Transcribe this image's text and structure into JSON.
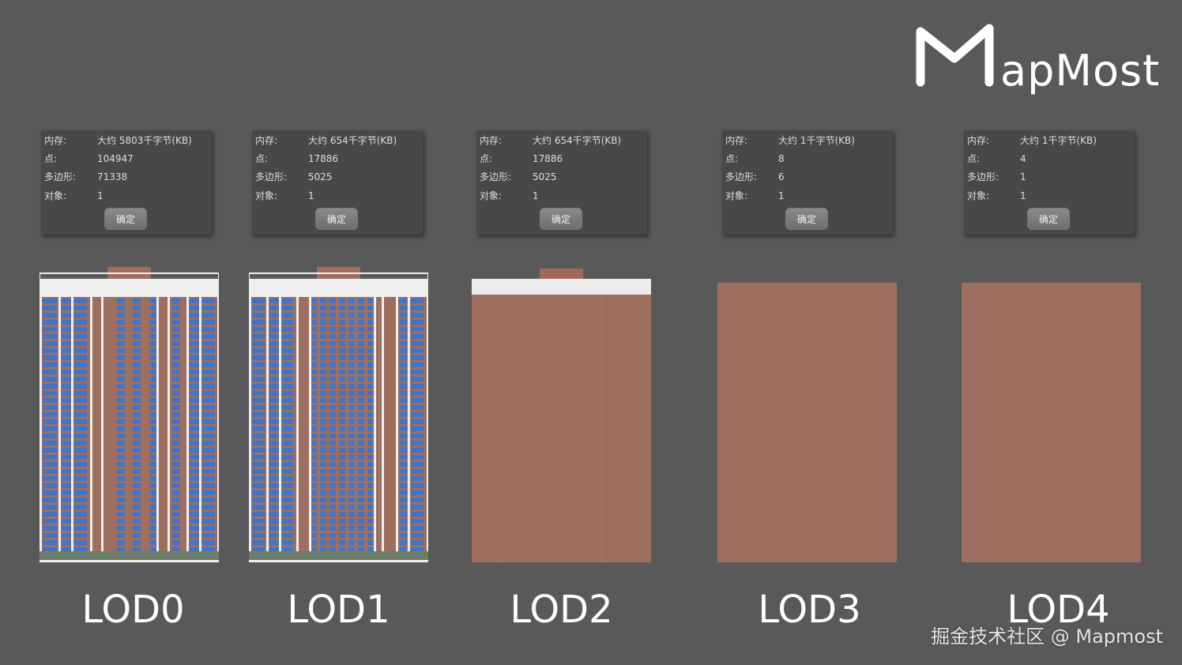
{
  "brand": {
    "name": "apMost",
    "color": "#ffffff"
  },
  "colors": {
    "background": "#595959",
    "brick": "#9e6e5e",
    "window_blue": "#3f74c8",
    "frame": "#efefef"
  },
  "lods": [
    {
      "label": "LOD0",
      "memory_label": "内存:",
      "memory": "大约 5803千字节(KB)",
      "points_label": "点:",
      "points": "104947",
      "polygons_label": "多边形:",
      "polygons": "71338",
      "objects_label": "对象:",
      "objects": "1",
      "ok": "确定"
    },
    {
      "label": "LOD1",
      "memory_label": "内存:",
      "memory": "大约 654千字节(KB)",
      "points_label": "点:",
      "points": "17886",
      "polygons_label": "多边形:",
      "polygons": "5025",
      "objects_label": "对象:",
      "objects": "1",
      "ok": "确定"
    },
    {
      "label": "LOD2",
      "memory_label": "内存:",
      "memory": "大约 654千字节(KB)",
      "points_label": "点:",
      "points": "17886",
      "polygons_label": "多边形:",
      "polygons": "5025",
      "objects_label": "对象:",
      "objects": "1",
      "ok": "确定"
    },
    {
      "label": "LOD3",
      "memory_label": "内存:",
      "memory": "大约 1千字节(KB)",
      "points_label": "点:",
      "points": "8",
      "polygons_label": "多边形:",
      "polygons": "6",
      "objects_label": "对象:",
      "objects": "1",
      "ok": "确定"
    },
    {
      "label": "LOD4",
      "memory_label": "内存:",
      "memory": "大约 1千字节(KB)",
      "points_label": "点:",
      "points": "4",
      "polygons_label": "多边形:",
      "polygons": "1",
      "objects_label": "对象:",
      "objects": "1",
      "ok": "确定"
    }
  ],
  "watermark": "掘金技术社区 @ Mapmost"
}
